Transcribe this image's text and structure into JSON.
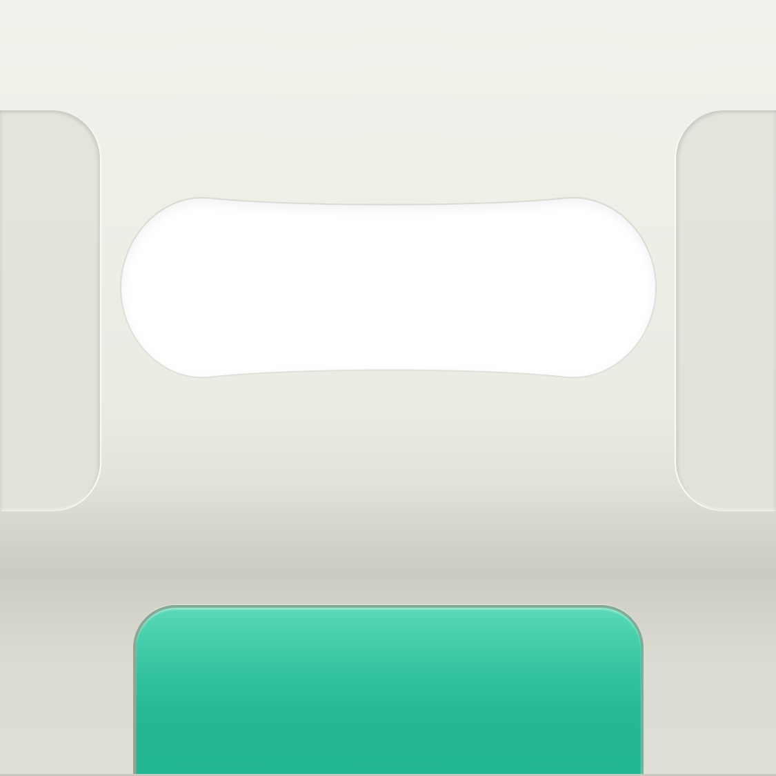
{
  "display": {
    "readout": ""
  },
  "primary_button": {
    "label": ""
  },
  "colors": {
    "background": "#efefe8",
    "rail": "#e3e3db",
    "display_well": "#ffffff",
    "accent": "#22b591",
    "accent_border": "#86aa98"
  }
}
